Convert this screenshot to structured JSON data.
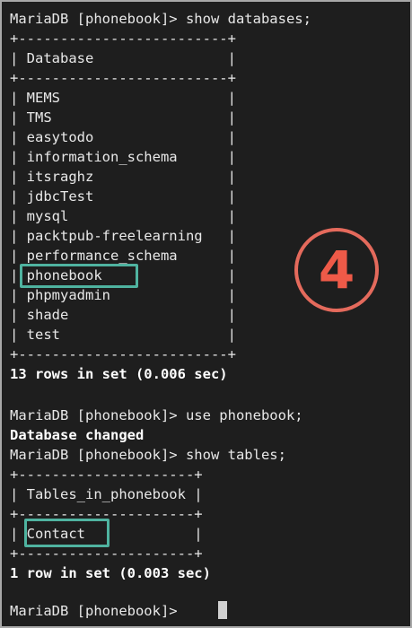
{
  "session1": {
    "prompt": "MariaDB [phonebook]> show databases;",
    "border": "+-------------------------+",
    "header": "| Database                |",
    "rows": [
      "| MEMS                    |",
      "| TMS                     |",
      "| easytodo                |",
      "| information_schema      |",
      "| itsraghz                |",
      "| jdbcTest                |",
      "| mysql                   |",
      "| packtpub-freelearning   |",
      "| performance_schema      |",
      "| phonebook               |",
      "| phpmyadmin              |",
      "| shade                   |",
      "| test                    |"
    ],
    "summary": "13 rows in set (0.006 sec)"
  },
  "session2": {
    "prompt": "MariaDB [phonebook]> use phonebook;",
    "result": "Database changed"
  },
  "session3": {
    "prompt": "MariaDB [phonebook]> show tables;",
    "border": "+---------------------+",
    "header": "| Tables_in_phonebook |",
    "rows": [
      "| Contact             |"
    ],
    "summary": "1 row in set (0.003 sec)"
  },
  "final_prompt": "MariaDB [phonebook]> ",
  "annotation_number": "4",
  "colors": {
    "background": "#1e1e1e",
    "text": "#e8e8e8",
    "highlight_box": "#4fb3a0",
    "badge": "#ee5a48"
  }
}
